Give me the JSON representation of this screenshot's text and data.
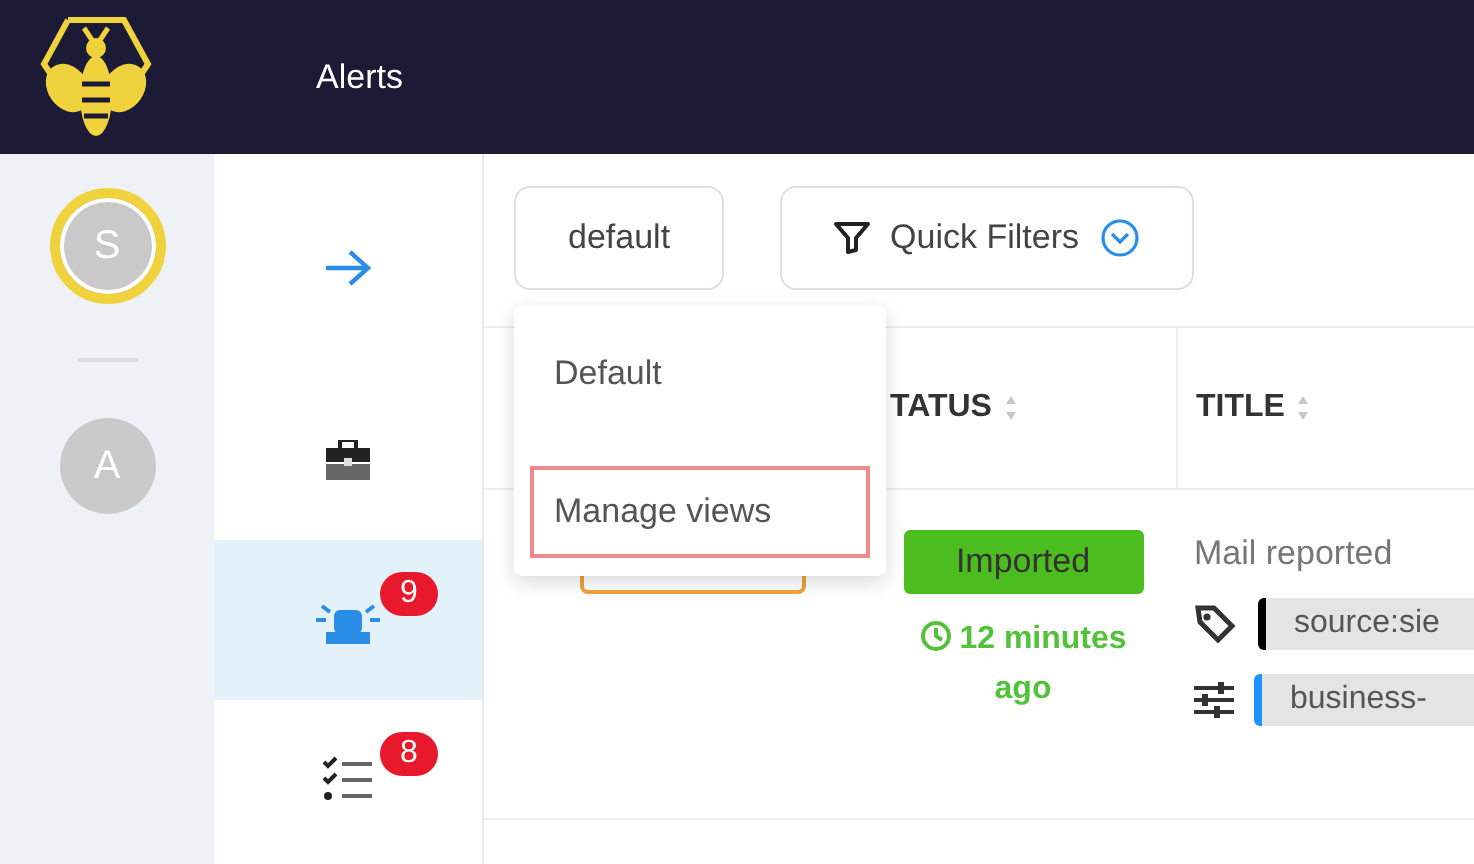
{
  "header": {
    "title": "Alerts"
  },
  "users": [
    {
      "initial": "S",
      "selected": true
    },
    {
      "initial": "A",
      "selected": false
    }
  ],
  "nav": [
    {
      "kind": "briefcase",
      "selected": false
    },
    {
      "kind": "siren",
      "selected": true,
      "badge": "9"
    },
    {
      "kind": "tasks",
      "selected": false,
      "badge": "8"
    }
  ],
  "toolbar": {
    "view_button": "default",
    "filter_button": "Quick Filters"
  },
  "view_menu": {
    "items": [
      {
        "label": "Default",
        "highlighted": false
      },
      {
        "label": "Manage views",
        "highlighted": true
      }
    ]
  },
  "table": {
    "columns": [
      {
        "label": "TATUS"
      },
      {
        "label": "TITLE"
      }
    ],
    "rows": [
      {
        "status": "Imported",
        "time": "12 minutes ago",
        "title": "Mail reported",
        "tags": [
          {
            "kind": "tag",
            "text": "source:sie",
            "color": "#000000"
          },
          {
            "kind": "field",
            "text": "business-",
            "color": "#1e90ff"
          }
        ]
      }
    ]
  }
}
